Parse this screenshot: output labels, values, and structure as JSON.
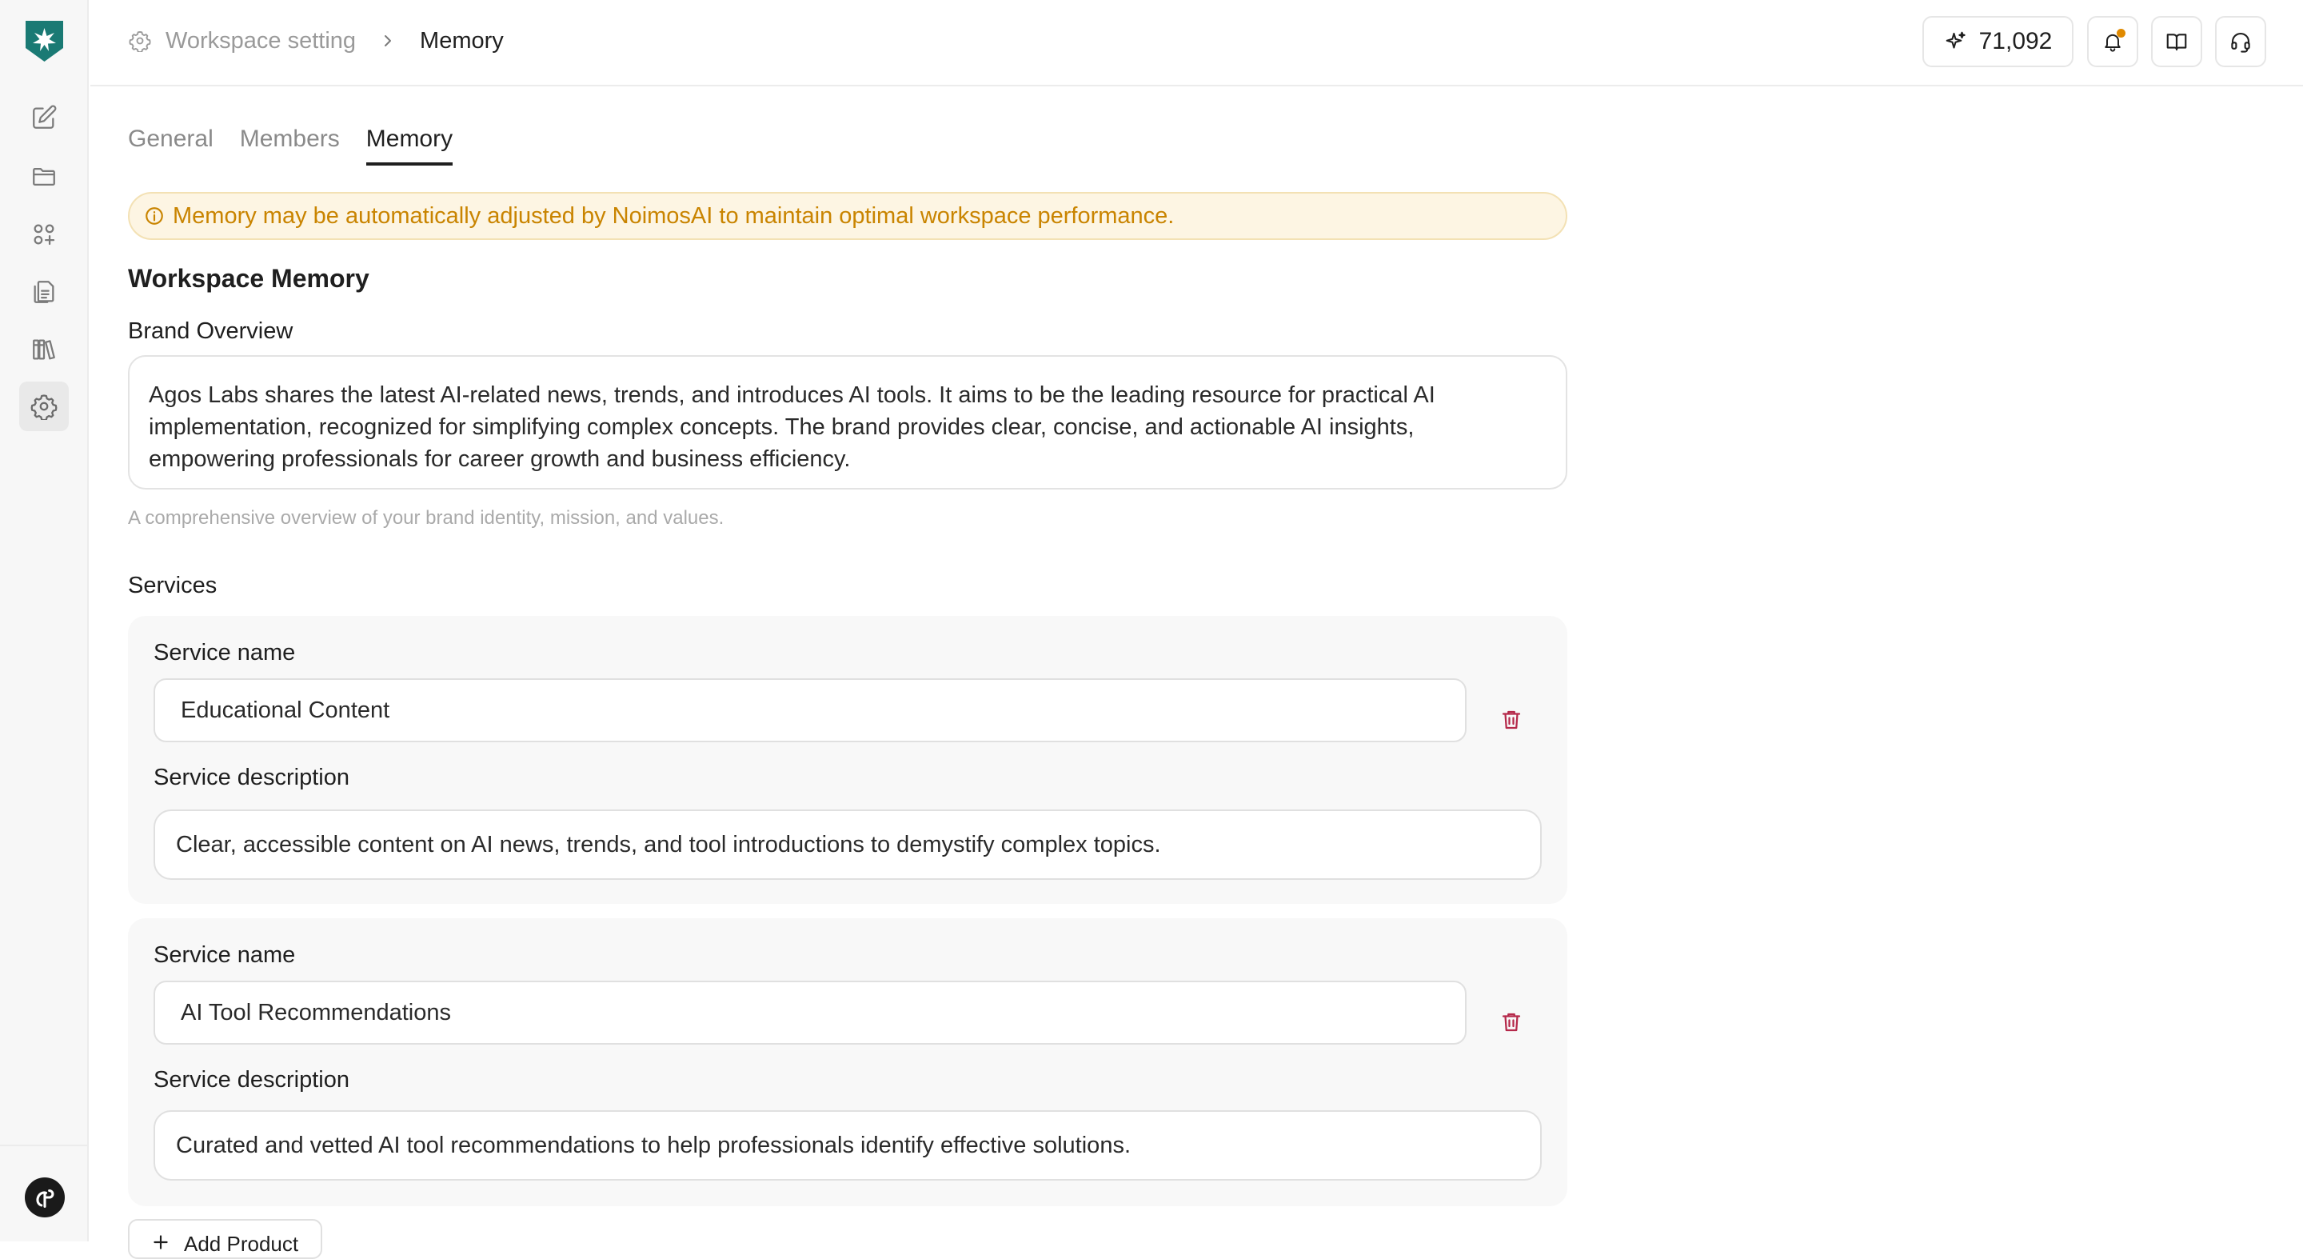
{
  "breadcrumb": {
    "parent": "Workspace setting",
    "current": "Memory"
  },
  "header": {
    "credits": "71,092",
    "notification_dot_color": "#e08a00"
  },
  "tabs": [
    {
      "label": "General"
    },
    {
      "label": "Members"
    },
    {
      "label": "Memory"
    }
  ],
  "notice": {
    "text": "Memory may be automatically adjusted by NoimosAI to maintain optimal workspace performance."
  },
  "memory": {
    "title": "Workspace Memory",
    "brand_overview_label": "Brand Overview",
    "brand_overview_value": "Agos Labs shares the latest AI-related news, trends, and introduces AI tools. It aims to be the leading resource for practical AI implementation, recognized for simplifying complex concepts. The brand provides clear, concise, and actionable AI insights, empowering professionals for career growth and business efficiency.",
    "brand_overview_helper": "A comprehensive overview of your brand identity, mission, and values.",
    "services_label": "Services",
    "services": [
      {
        "name_label": "Service name",
        "name": "Educational Content",
        "description_label": "Service description",
        "description": "Clear, accessible content on AI news, trends, and tool introductions to demystify complex topics."
      },
      {
        "name_label": "Service name",
        "name": "AI Tool Recommendations",
        "description_label": "Service description",
        "description": "Curated and vetted AI tool recommendations to help professionals identify effective solutions."
      }
    ],
    "add_product_label": "Add Product"
  },
  "colors": {
    "brand": "#1a7a74",
    "warning": "#c98400",
    "danger": "#b5294a"
  }
}
